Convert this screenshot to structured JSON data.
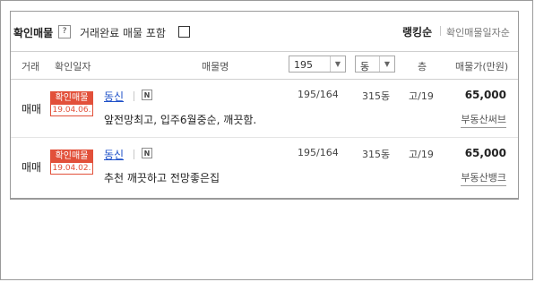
{
  "toolbar": {
    "title": "확인매물",
    "help_icon": "?",
    "include_completed_label": "거래완료 매물 포함",
    "sort_rank": "랭킹순",
    "sort_confirm_date": "확인매물일자순"
  },
  "columns": {
    "deal_type": "거래",
    "confirm_date": "확인일자",
    "listing_name": "매물명",
    "area_select": "195",
    "dong_select": "동",
    "floor": "층",
    "price": "매물가(만원)"
  },
  "listings": [
    {
      "deal_type": "매매",
      "badge": "확인매물",
      "date": "19.04.06.",
      "name": "동신",
      "nbadge": "N",
      "description": "앞전망최고, 입주6월중순, 깨끗함.",
      "area": "195/164",
      "dong": "315동",
      "floor": "고/19",
      "price": "65,000",
      "agency": "부동산써브"
    },
    {
      "deal_type": "매매",
      "badge": "확인매물",
      "date": "19.04.02.",
      "name": "동신",
      "nbadge": "N",
      "description": "추천 깨끗하고 전망좋은집",
      "area": "195/164",
      "dong": "315동",
      "floor": "고/19",
      "price": "65,000",
      "agency": "부동산뱅크"
    }
  ],
  "colors": {
    "badge_red": "#e2503a",
    "link_blue": "#1e50c8",
    "border": "#9a9a9a"
  }
}
